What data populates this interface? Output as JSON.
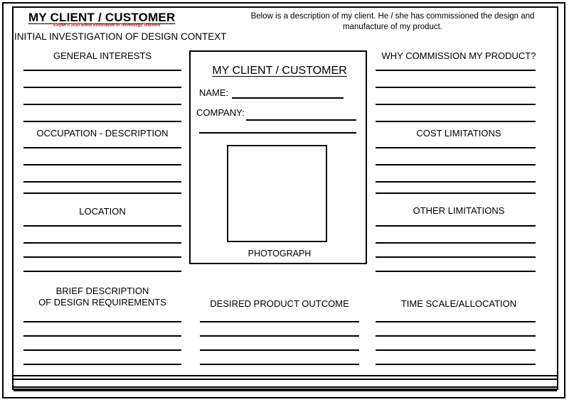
{
  "header": {
    "title": "MY CLIENT / CUSTOMER",
    "credit": "V.Ryan © 2010 World Association of Technology Teachers",
    "subtitle": "INITIAL INVESTIGATION OF DESIGN CONTEXT",
    "description": "Below is a description of my client. He / she has commissioned the design and manufacture of my product."
  },
  "client_box": {
    "title": "MY CLIENT / CUSTOMER",
    "name_label": "NAME:",
    "company_label": "COMPANY:",
    "photo_caption": "PHOTOGRAPH"
  },
  "sections": {
    "general_interests": {
      "heading": "GENERAL INTERESTS",
      "lines": 4
    },
    "occupation": {
      "heading": "OCCUPATION - DESCRIPTION",
      "lines": 4
    },
    "location": {
      "heading": "LOCATION",
      "lines": 4
    },
    "why_commission": {
      "heading": "WHY COMMISSION MY PRODUCT?",
      "lines": 4
    },
    "cost_limitations": {
      "heading": "COST LIMITATIONS",
      "lines": 4
    },
    "other_limitations": {
      "heading": "OTHER LIMITATIONS",
      "lines": 4
    },
    "brief_description": {
      "heading": "BRIEF DESCRIPTION\nOF DESIGN REQUIREMENTS",
      "lines": 4
    },
    "desired_outcome": {
      "heading": "DESIRED PRODUCT OUTCOME",
      "lines": 4
    },
    "time_scale": {
      "heading": "TIME SCALE/ALLOCATION",
      "lines": 4
    }
  },
  "colors": {
    "ink": "#000000",
    "credit": "#d11b1b",
    "paper": "#ffffff"
  }
}
